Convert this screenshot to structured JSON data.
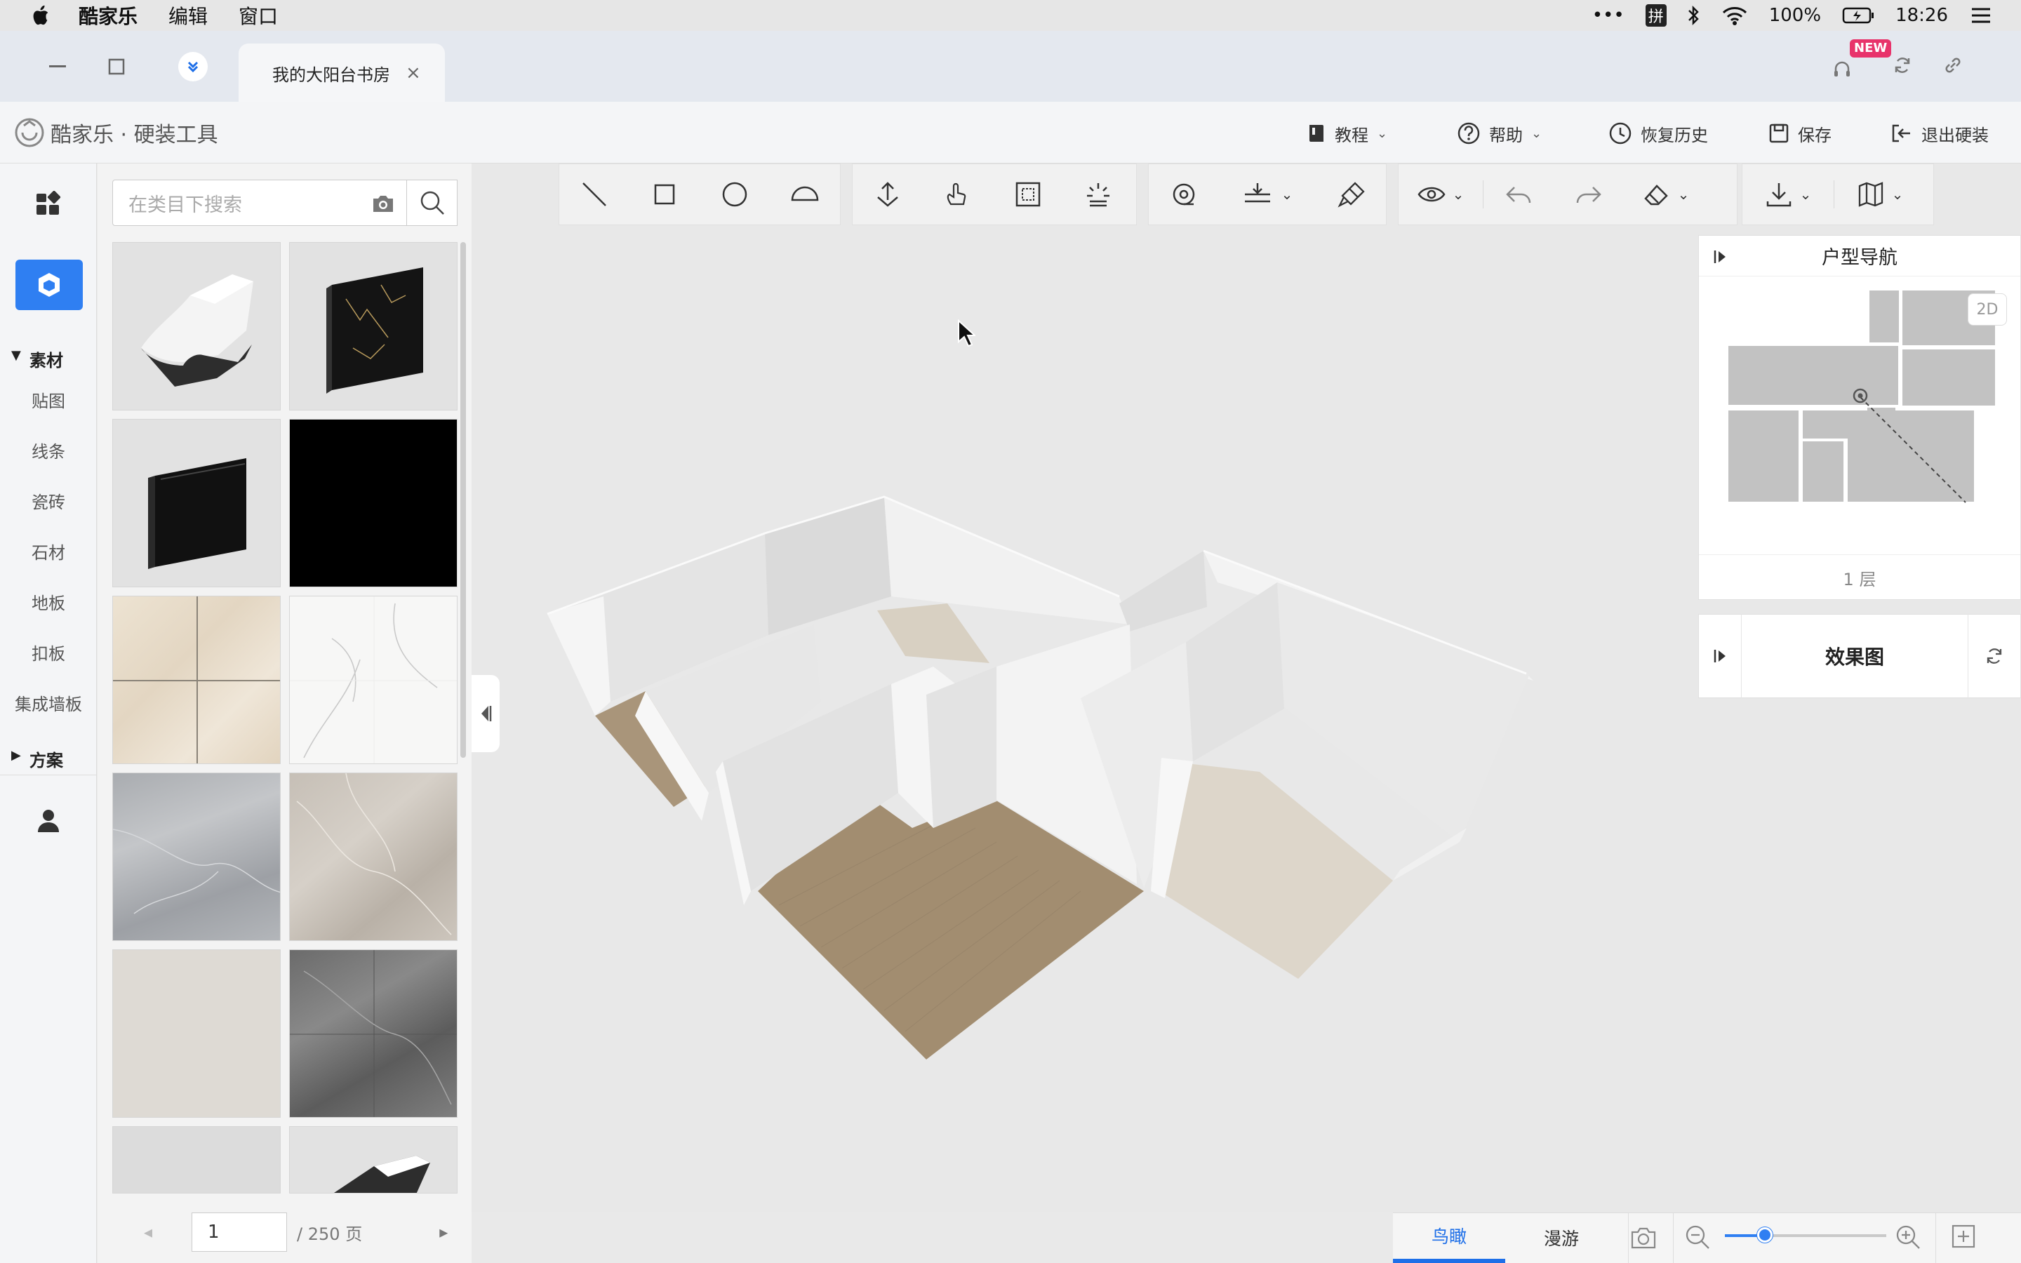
{
  "menubar": {
    "app_name": "酷家乐",
    "items": [
      "编辑",
      "窗口"
    ],
    "input_method": "拼",
    "battery": "100%",
    "clock": "18:26"
  },
  "tabbar": {
    "doc_tab": "我的大阳台书房",
    "close_glyph": "×",
    "new_badge": "NEW"
  },
  "header": {
    "logo": "酷家乐 · 硬装工具",
    "tutorial": "教程",
    "help": "帮助",
    "history": "恢复历史",
    "save": "保存",
    "exit": "退出硬装"
  },
  "rail": {
    "group_material": "素材",
    "items": [
      "贴图",
      "线条",
      "瓷砖",
      "石材",
      "地板",
      "扣板",
      "集成墙板"
    ],
    "group_plan": "方案"
  },
  "panel": {
    "search_placeholder": "在类目下搜索",
    "pager_current": "1",
    "pager_total": "/ 250 页"
  },
  "nav_panel": {
    "title": "户型导航",
    "mode_badge": "2D",
    "floor": "1 层"
  },
  "render_panel": {
    "title": "效果图"
  },
  "bottom": {
    "view_bird": "鸟瞰",
    "view_walk": "漫游"
  },
  "colors": {
    "accent": "#2f7ff2",
    "rail_active": "#2f7ff2",
    "new_badge": "#e8336b",
    "floor_wood": "#a9957a",
    "floor_marble": "#ded7cb"
  },
  "icons": {
    "toolbar": [
      "line-tool",
      "rectangle-tool",
      "circle-tool",
      "arc-tool",
      "move-tool",
      "hand-tool",
      "fit-tool",
      "lighting-tool",
      "locate-tool",
      "align-tool",
      "brush-tool",
      "eye-view",
      "undo",
      "redo",
      "eraser",
      "download",
      "map-view"
    ]
  }
}
